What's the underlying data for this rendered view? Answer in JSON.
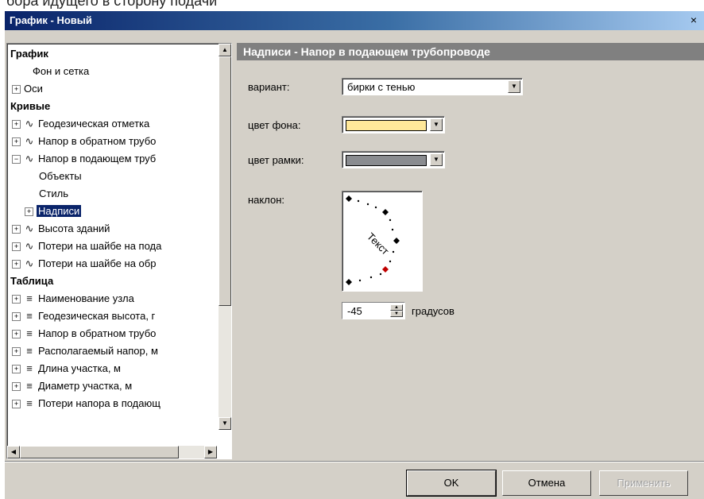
{
  "cutoff_text": "бора идущего в сторону подачи",
  "window": {
    "title": "График - Новый",
    "close_label": "×"
  },
  "tree": {
    "rows": [
      {
        "label": "График",
        "kind": "header"
      },
      {
        "label": "Фон и сетка",
        "kind": "leaf"
      },
      {
        "label": "Оси",
        "kind": "expand"
      },
      {
        "label": "Кривые",
        "kind": "header"
      },
      {
        "label": "Геодезическая отметка",
        "kind": "curve",
        "pm": "+"
      },
      {
        "label": "Напор в обратном трубо",
        "kind": "curve",
        "pm": "+"
      },
      {
        "label": "Напор в подающем труб",
        "kind": "curve",
        "pm": "−"
      },
      {
        "label": "Объекты",
        "kind": "child"
      },
      {
        "label": "Стиль",
        "kind": "child"
      },
      {
        "label": "Надписи",
        "kind": "selected",
        "pm": "+"
      },
      {
        "label": "Высота зданий",
        "kind": "curve",
        "pm": "+"
      },
      {
        "label": "Потери на шайбе на пода",
        "kind": "curve",
        "pm": "+"
      },
      {
        "label": "Потери на шайбе на обр",
        "kind": "curve",
        "pm": "+"
      },
      {
        "label": "Таблица",
        "kind": "header"
      },
      {
        "label": "Наименование узла",
        "kind": "table",
        "pm": "+"
      },
      {
        "label": "Геодезическая высота, г",
        "kind": "table",
        "pm": "+"
      },
      {
        "label": "Напор в обратном трубо",
        "kind": "table",
        "pm": "+"
      },
      {
        "label": "Располагаемый напор, м",
        "kind": "table",
        "pm": "+"
      },
      {
        "label": "Длина участка, м",
        "kind": "table",
        "pm": "+"
      },
      {
        "label": "Диаметр участка, м",
        "kind": "table",
        "pm": "+"
      },
      {
        "label": "Потери напора в подающ",
        "kind": "table",
        "pm": "+"
      }
    ]
  },
  "panel": {
    "title": "Надписи - Напор в подающем трубопроводе",
    "variant_label": "вариант:",
    "variant_value": "бирки с тенью",
    "bg_color_label": "цвет фона:",
    "bg_color": "#ffe89a",
    "border_color_label": "цвет рамки:",
    "border_color": "#8a8c90",
    "angle_label": "наклон:",
    "dial_text": "Текст",
    "angle_value": "-45",
    "angle_unit": "градусов"
  },
  "buttons": {
    "ok": "OK",
    "cancel": "Отмена",
    "apply": "Применить"
  }
}
